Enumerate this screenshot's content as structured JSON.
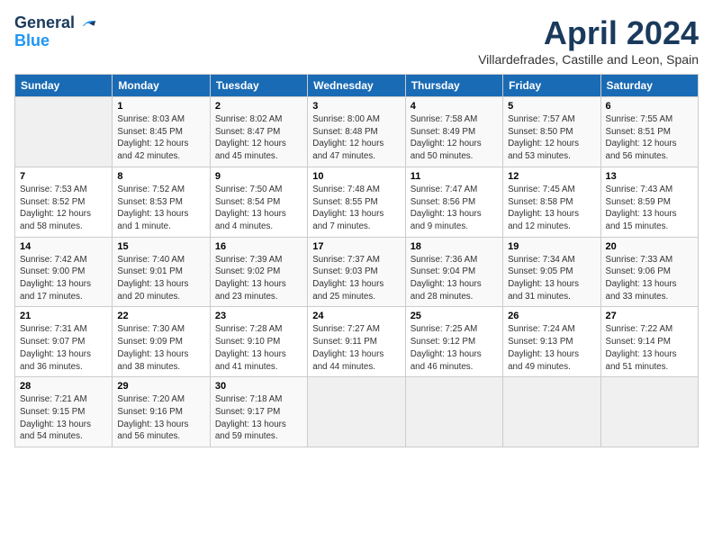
{
  "header": {
    "logo_line1": "General",
    "logo_line2": "Blue",
    "month": "April 2024",
    "location": "Villardefrades, Castille and Leon, Spain"
  },
  "columns": [
    "Sunday",
    "Monday",
    "Tuesday",
    "Wednesday",
    "Thursday",
    "Friday",
    "Saturday"
  ],
  "weeks": [
    [
      {
        "day": "",
        "sunrise": "",
        "sunset": "",
        "daylight": ""
      },
      {
        "day": "1",
        "sunrise": "Sunrise: 8:03 AM",
        "sunset": "Sunset: 8:45 PM",
        "daylight": "Daylight: 12 hours and 42 minutes."
      },
      {
        "day": "2",
        "sunrise": "Sunrise: 8:02 AM",
        "sunset": "Sunset: 8:47 PM",
        "daylight": "Daylight: 12 hours and 45 minutes."
      },
      {
        "day": "3",
        "sunrise": "Sunrise: 8:00 AM",
        "sunset": "Sunset: 8:48 PM",
        "daylight": "Daylight: 12 hours and 47 minutes."
      },
      {
        "day": "4",
        "sunrise": "Sunrise: 7:58 AM",
        "sunset": "Sunset: 8:49 PM",
        "daylight": "Daylight: 12 hours and 50 minutes."
      },
      {
        "day": "5",
        "sunrise": "Sunrise: 7:57 AM",
        "sunset": "Sunset: 8:50 PM",
        "daylight": "Daylight: 12 hours and 53 minutes."
      },
      {
        "day": "6",
        "sunrise": "Sunrise: 7:55 AM",
        "sunset": "Sunset: 8:51 PM",
        "daylight": "Daylight: 12 hours and 56 minutes."
      }
    ],
    [
      {
        "day": "7",
        "sunrise": "Sunrise: 7:53 AM",
        "sunset": "Sunset: 8:52 PM",
        "daylight": "Daylight: 12 hours and 58 minutes."
      },
      {
        "day": "8",
        "sunrise": "Sunrise: 7:52 AM",
        "sunset": "Sunset: 8:53 PM",
        "daylight": "Daylight: 13 hours and 1 minute."
      },
      {
        "day": "9",
        "sunrise": "Sunrise: 7:50 AM",
        "sunset": "Sunset: 8:54 PM",
        "daylight": "Daylight: 13 hours and 4 minutes."
      },
      {
        "day": "10",
        "sunrise": "Sunrise: 7:48 AM",
        "sunset": "Sunset: 8:55 PM",
        "daylight": "Daylight: 13 hours and 7 minutes."
      },
      {
        "day": "11",
        "sunrise": "Sunrise: 7:47 AM",
        "sunset": "Sunset: 8:56 PM",
        "daylight": "Daylight: 13 hours and 9 minutes."
      },
      {
        "day": "12",
        "sunrise": "Sunrise: 7:45 AM",
        "sunset": "Sunset: 8:58 PM",
        "daylight": "Daylight: 13 hours and 12 minutes."
      },
      {
        "day": "13",
        "sunrise": "Sunrise: 7:43 AM",
        "sunset": "Sunset: 8:59 PM",
        "daylight": "Daylight: 13 hours and 15 minutes."
      }
    ],
    [
      {
        "day": "14",
        "sunrise": "Sunrise: 7:42 AM",
        "sunset": "Sunset: 9:00 PM",
        "daylight": "Daylight: 13 hours and 17 minutes."
      },
      {
        "day": "15",
        "sunrise": "Sunrise: 7:40 AM",
        "sunset": "Sunset: 9:01 PM",
        "daylight": "Daylight: 13 hours and 20 minutes."
      },
      {
        "day": "16",
        "sunrise": "Sunrise: 7:39 AM",
        "sunset": "Sunset: 9:02 PM",
        "daylight": "Daylight: 13 hours and 23 minutes."
      },
      {
        "day": "17",
        "sunrise": "Sunrise: 7:37 AM",
        "sunset": "Sunset: 9:03 PM",
        "daylight": "Daylight: 13 hours and 25 minutes."
      },
      {
        "day": "18",
        "sunrise": "Sunrise: 7:36 AM",
        "sunset": "Sunset: 9:04 PM",
        "daylight": "Daylight: 13 hours and 28 minutes."
      },
      {
        "day": "19",
        "sunrise": "Sunrise: 7:34 AM",
        "sunset": "Sunset: 9:05 PM",
        "daylight": "Daylight: 13 hours and 31 minutes."
      },
      {
        "day": "20",
        "sunrise": "Sunrise: 7:33 AM",
        "sunset": "Sunset: 9:06 PM",
        "daylight": "Daylight: 13 hours and 33 minutes."
      }
    ],
    [
      {
        "day": "21",
        "sunrise": "Sunrise: 7:31 AM",
        "sunset": "Sunset: 9:07 PM",
        "daylight": "Daylight: 13 hours and 36 minutes."
      },
      {
        "day": "22",
        "sunrise": "Sunrise: 7:30 AM",
        "sunset": "Sunset: 9:09 PM",
        "daylight": "Daylight: 13 hours and 38 minutes."
      },
      {
        "day": "23",
        "sunrise": "Sunrise: 7:28 AM",
        "sunset": "Sunset: 9:10 PM",
        "daylight": "Daylight: 13 hours and 41 minutes."
      },
      {
        "day": "24",
        "sunrise": "Sunrise: 7:27 AM",
        "sunset": "Sunset: 9:11 PM",
        "daylight": "Daylight: 13 hours and 44 minutes."
      },
      {
        "day": "25",
        "sunrise": "Sunrise: 7:25 AM",
        "sunset": "Sunset: 9:12 PM",
        "daylight": "Daylight: 13 hours and 46 minutes."
      },
      {
        "day": "26",
        "sunrise": "Sunrise: 7:24 AM",
        "sunset": "Sunset: 9:13 PM",
        "daylight": "Daylight: 13 hours and 49 minutes."
      },
      {
        "day": "27",
        "sunrise": "Sunrise: 7:22 AM",
        "sunset": "Sunset: 9:14 PM",
        "daylight": "Daylight: 13 hours and 51 minutes."
      }
    ],
    [
      {
        "day": "28",
        "sunrise": "Sunrise: 7:21 AM",
        "sunset": "Sunset: 9:15 PM",
        "daylight": "Daylight: 13 hours and 54 minutes."
      },
      {
        "day": "29",
        "sunrise": "Sunrise: 7:20 AM",
        "sunset": "Sunset: 9:16 PM",
        "daylight": "Daylight: 13 hours and 56 minutes."
      },
      {
        "day": "30",
        "sunrise": "Sunrise: 7:18 AM",
        "sunset": "Sunset: 9:17 PM",
        "daylight": "Daylight: 13 hours and 59 minutes."
      },
      {
        "day": "",
        "sunrise": "",
        "sunset": "",
        "daylight": ""
      },
      {
        "day": "",
        "sunrise": "",
        "sunset": "",
        "daylight": ""
      },
      {
        "day": "",
        "sunrise": "",
        "sunset": "",
        "daylight": ""
      },
      {
        "day": "",
        "sunrise": "",
        "sunset": "",
        "daylight": ""
      }
    ]
  ]
}
